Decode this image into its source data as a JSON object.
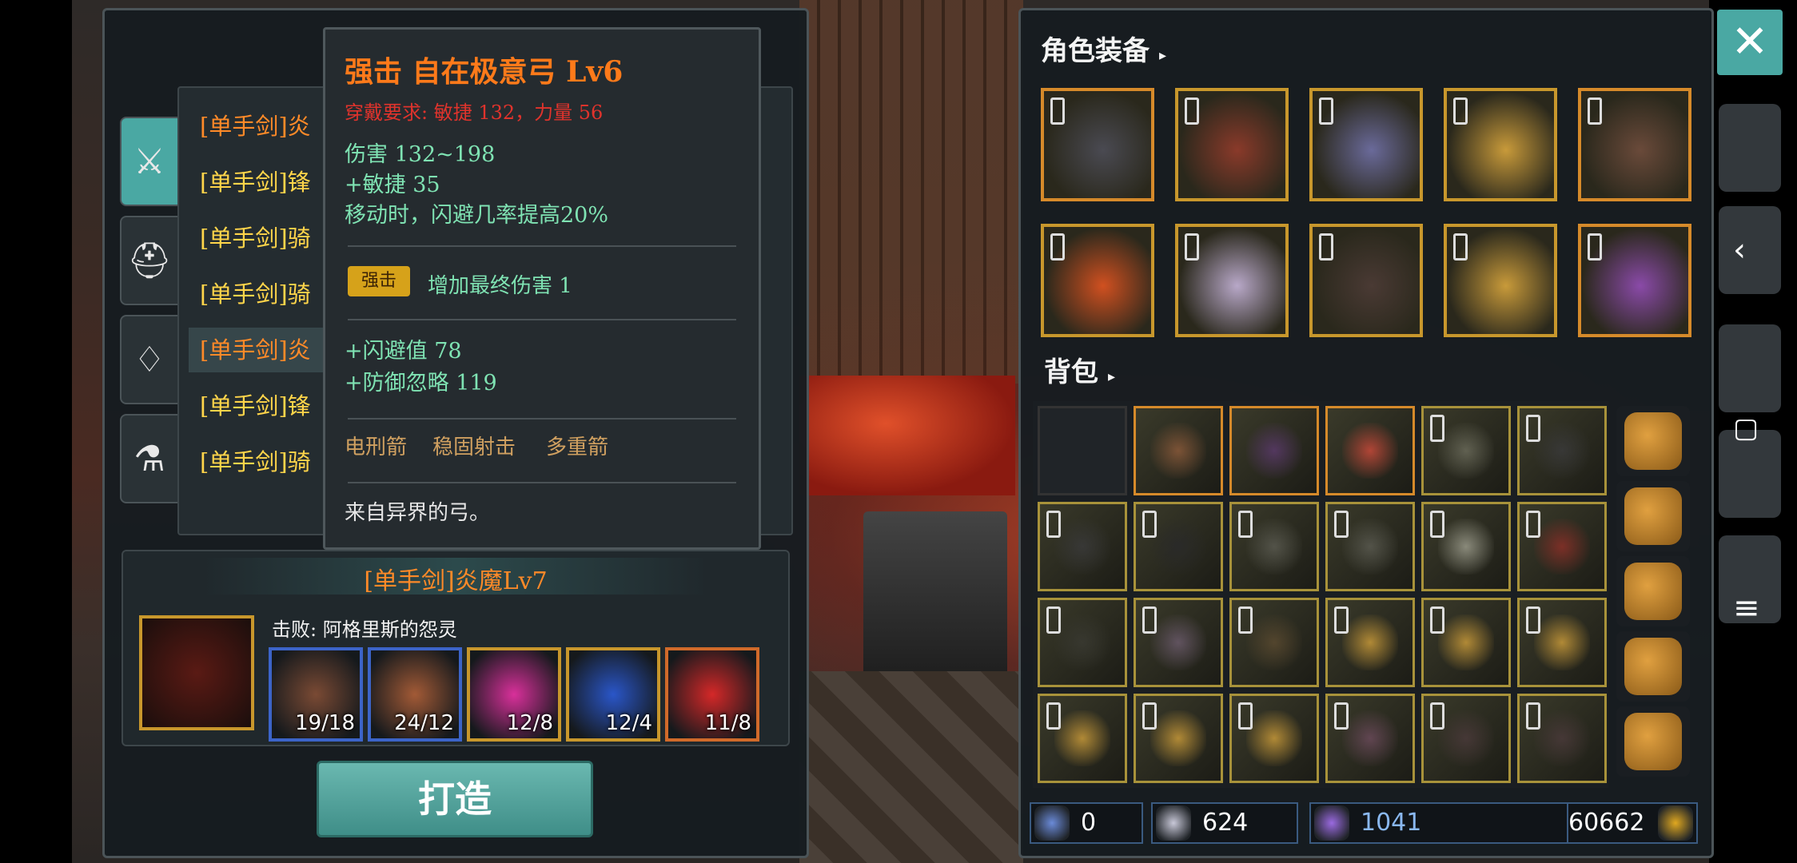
{
  "tooltip": {
    "title": "强击 自在极意弓 Lv6",
    "requirement": "穿戴要求:  敏捷 132，力量 56",
    "stats": [
      "伤害  132~198",
      "+敏捷 35",
      "移动时，闪避几率提高20%"
    ],
    "badge": "强击",
    "skill_text": "增加最终伤害 1",
    "bonus": [
      "+闪避值 78",
      "+防御忽略 119"
    ],
    "skills": [
      "电刑箭",
      "稳固射击",
      "多重箭"
    ],
    "flavor": "来自异界的弓。"
  },
  "weapon_list": [
    {
      "label": "[单手剑]炎",
      "color": "orange"
    },
    {
      "label": "[单手剑]锋",
      "color": "yellow"
    },
    {
      "label": "[单手剑]骑",
      "color": "yellow"
    },
    {
      "label": "[单手剑]骑",
      "color": "yellow"
    },
    {
      "label": "[单手剑]炎",
      "color": "orange",
      "selected": true
    },
    {
      "label": "[单手剑]锋",
      "color": "yellow"
    },
    {
      "label": "[单手剑]骑",
      "color": "yellow"
    }
  ],
  "category_tabs": [
    "sword-icon",
    "helmet-icon",
    "necklace-icon",
    "potion-icon"
  ],
  "craft": {
    "title": "[单手剑]炎魔Lv7",
    "defeat": "击败: 阿格里斯的怨灵",
    "materials": [
      {
        "name": "fur-material",
        "count": "19/18",
        "border": "blue",
        "color": "#7a4a34"
      },
      {
        "name": "fur-material-2",
        "count": "24/12",
        "border": "blue",
        "color": "#a25a36"
      },
      {
        "name": "pink-crystal-material",
        "count": "12/8",
        "border": "gold",
        "color": "#d8309a"
      },
      {
        "name": "blue-gem-material",
        "count": "12/4",
        "border": "gold",
        "color": "#2a56c8"
      },
      {
        "name": "red-crystal-material",
        "count": "11/8",
        "border": "orange",
        "color": "#d42828"
      }
    ],
    "button": "打造"
  },
  "equipment": {
    "title": "角色装备",
    "slots": [
      {
        "name": "helmet-slot",
        "color": "#4a4a52",
        "border": "orange"
      },
      {
        "name": "chest-armor-slot",
        "color": "#8a3a2a",
        "border": "gold"
      },
      {
        "name": "leg-armor-slot",
        "color": "#6a6a9a",
        "border": "gold"
      },
      {
        "name": "ring-slot-1",
        "color": "#c89a3a",
        "border": "gold"
      },
      {
        "name": "weapon-slot",
        "color": "#6a4a3a",
        "border": "orange"
      },
      {
        "name": "necklace-slot",
        "color": "#d05020",
        "border": "gold"
      },
      {
        "name": "gloves-slot",
        "color": "#b8a8c8",
        "border": "gold"
      },
      {
        "name": "boots-slot",
        "color": "#4a3a34",
        "border": "gold"
      },
      {
        "name": "ring-slot-2",
        "color": "#c89a3a",
        "border": "gold"
      },
      {
        "name": "offhand-slot",
        "color": "#8a4aa8",
        "border": "orange"
      }
    ]
  },
  "backpack": {
    "title": "背包",
    "items": [
      {
        "name": "empty-slot",
        "color": "",
        "border": "empty"
      },
      {
        "name": "bow-item",
        "color": "#8a5a3a",
        "border": "orange"
      },
      {
        "name": "scarecrow-item",
        "color": "#5a3a6a",
        "border": "orange"
      },
      {
        "name": "armor-set-item",
        "color": "#c84a3a",
        "border": "orange"
      },
      {
        "name": "gauntlet-item",
        "color": "#6a6a5a",
        "border": "gold"
      },
      {
        "name": "helmet-item",
        "color": "#3a3a3a",
        "border": "gold"
      },
      {
        "name": "glove-item",
        "color": "#3a3a3a",
        "border": "gold"
      },
      {
        "name": "chainmail-item",
        "color": "#2a2a2a",
        "border": "gold"
      },
      {
        "name": "plate-armor-item",
        "color": "#5a5a50",
        "border": "gold"
      },
      {
        "name": "plate-armor-item-2",
        "color": "#5a5a50",
        "border": "gold"
      },
      {
        "name": "knight-helmet-item",
        "color": "#9a9a8a",
        "border": "gold"
      },
      {
        "name": "red-tunic-item",
        "color": "#8a3028",
        "border": "gold"
      },
      {
        "name": "hammer-item",
        "color": "#3a3a32",
        "border": "gold"
      },
      {
        "name": "axe-item",
        "color": "#6a5a6a",
        "border": "gold"
      },
      {
        "name": "bow-item-2",
        "color": "#5a4a30",
        "border": "gold"
      },
      {
        "name": "ring-item-1",
        "color": "#c89a3a",
        "border": "gold"
      },
      {
        "name": "ring-item-2",
        "color": "#c89a3a",
        "border": "gold"
      },
      {
        "name": "ring-item-3",
        "color": "#c89a3a",
        "border": "gold"
      },
      {
        "name": "ring-item-4",
        "color": "#c89a3a",
        "border": "gold"
      },
      {
        "name": "ring-item-5",
        "color": "#c89a3a",
        "border": "gold"
      },
      {
        "name": "ring-item-6",
        "color": "#c89a3a",
        "border": "gold"
      },
      {
        "name": "hat-item",
        "color": "#6a4a5a",
        "border": "gold"
      },
      {
        "name": "spear-item-1",
        "color": "#4a3a3a",
        "border": "gold"
      },
      {
        "name": "spear-item-2",
        "color": "#4a3a3a",
        "border": "gold"
      }
    ]
  },
  "side_bags": [
    "large-bag-icon",
    "medium-bag-icon",
    "small-bag-icon",
    "small-bag-icon-2",
    "pouch-icon"
  ],
  "currency": [
    {
      "name": "wand-currency",
      "value": "0",
      "color": "#6a8ad8"
    },
    {
      "name": "heart-currency",
      "value": "624",
      "color": "#c8c8d8"
    },
    {
      "name": "crystal-currency",
      "value": "1041",
      "color": "#9a6ae0"
    },
    {
      "name": "gold-currency",
      "value": "60662",
      "color": "#e0a820"
    }
  ],
  "close_label": "✕"
}
